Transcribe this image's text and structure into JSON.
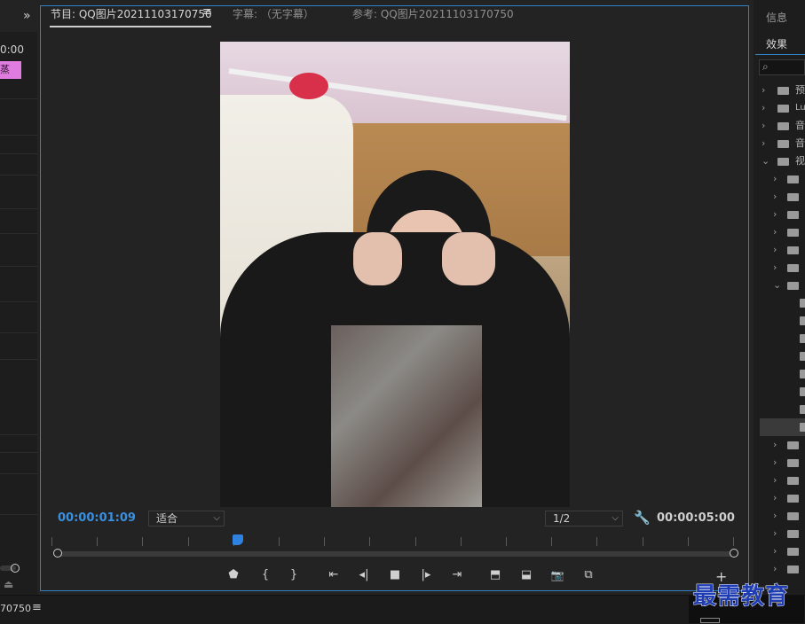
{
  "left_panel": {
    "time": "0:00",
    "clip_label": "蒸",
    "collapse_glyph": "»",
    "export_glyph": "⏏"
  },
  "monitor": {
    "tabs": [
      {
        "label": "节目: QQ图片20211103170750"
      },
      {
        "label": "字幕: （无字幕）"
      },
      {
        "label": "参考: QQ图片20211103170750"
      }
    ],
    "menu_glyph": "≡",
    "current_timecode": "00:00:01:09",
    "duration_timecode": "00:00:05:00",
    "zoom_select": "适合",
    "resolution_select": "1/2",
    "add_glyph": "+",
    "transport": {
      "marker": "⬟",
      "mark_in": "{",
      "mark_out": "}",
      "go_to_in": "⇤",
      "step_back": "◂|",
      "stop": "■",
      "step_forward": "|▸",
      "go_to_out": "⇥",
      "lift": "⬒",
      "extract": "⬓",
      "export_frame": "📷",
      "compare": "⧉"
    }
  },
  "effects_panel": {
    "info_tab": "信息",
    "effects_tab": "效果",
    "tree": [
      {
        "label": "预",
        "expanded": false
      },
      {
        "label": "Lu",
        "expanded": false
      },
      {
        "label": "音",
        "expanded": false
      },
      {
        "label": "音",
        "expanded": false
      },
      {
        "label": "视",
        "expanded": true
      }
    ]
  },
  "bottom": {
    "title": "70750",
    "menu_glyph": "≡",
    "watermark": "最需教育"
  },
  "colors": {
    "accent": "#2f82c8",
    "timecode": "#3a90e0",
    "clip_pink": "#e07be0"
  }
}
